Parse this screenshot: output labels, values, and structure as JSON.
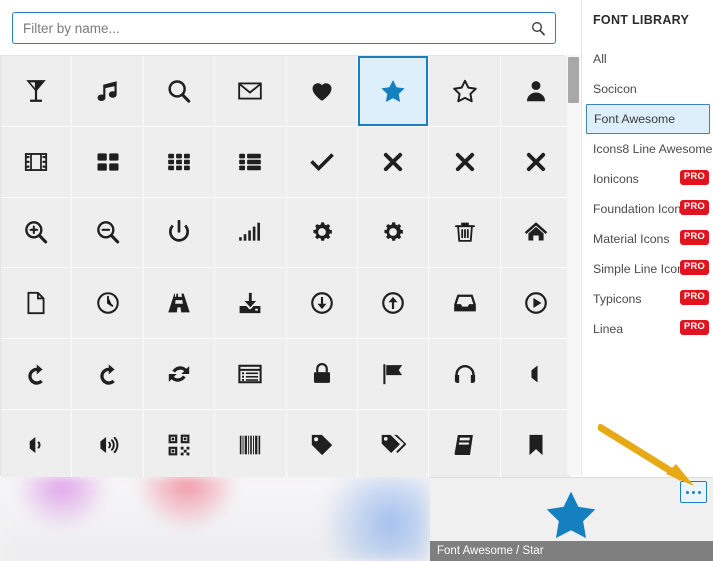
{
  "search": {
    "placeholder": "Filter by name...",
    "value": "",
    "icon": "search-icon"
  },
  "sidebar": {
    "title": "FONT LIBRARY",
    "items": [
      {
        "label": "All",
        "pro": "",
        "selected": false
      },
      {
        "label": "Socicon",
        "pro": "",
        "selected": false
      },
      {
        "label": "Font Awesome",
        "pro": "",
        "selected": true
      },
      {
        "label": "Icons8 Line Awesome",
        "pro": "",
        "selected": false
      },
      {
        "label": "Ionicons",
        "pro": "PRO",
        "selected": false
      },
      {
        "label": "Foundation Icons",
        "pro": "PRO",
        "selected": false
      },
      {
        "label": "Material Icons",
        "pro": "PRO",
        "selected": false
      },
      {
        "label": "Simple Line Icons",
        "pro": "PRO",
        "selected": false
      },
      {
        "label": "Typicons",
        "pro": "PRO",
        "selected": false
      },
      {
        "label": "Linea",
        "pro": "PRO",
        "selected": false
      }
    ]
  },
  "grid": {
    "columns": 8,
    "rows": 6,
    "icons": [
      {
        "name": "glass-icon",
        "selected": false
      },
      {
        "name": "music-icon",
        "selected": false
      },
      {
        "name": "search-icon",
        "selected": false
      },
      {
        "name": "envelope-icon",
        "selected": false
      },
      {
        "name": "heart-icon",
        "selected": false
      },
      {
        "name": "star-icon",
        "selected": true
      },
      {
        "name": "star-outline-icon",
        "selected": false
      },
      {
        "name": "user-icon",
        "selected": false
      },
      {
        "name": "film-icon",
        "selected": false
      },
      {
        "name": "th-large-icon",
        "selected": false
      },
      {
        "name": "th-icon",
        "selected": false
      },
      {
        "name": "th-list-icon",
        "selected": false
      },
      {
        "name": "check-icon",
        "selected": false
      },
      {
        "name": "close-icon",
        "selected": false
      },
      {
        "name": "remove-icon",
        "selected": false
      },
      {
        "name": "times-icon",
        "selected": false
      },
      {
        "name": "search-plus-icon",
        "selected": false
      },
      {
        "name": "search-minus-icon",
        "selected": false
      },
      {
        "name": "power-off-icon",
        "selected": false
      },
      {
        "name": "signal-icon",
        "selected": false
      },
      {
        "name": "cog-icon",
        "selected": false
      },
      {
        "name": "gear-icon",
        "selected": false
      },
      {
        "name": "trash-icon",
        "selected": false
      },
      {
        "name": "home-icon",
        "selected": false
      },
      {
        "name": "file-outline-icon",
        "selected": false
      },
      {
        "name": "clock-icon",
        "selected": false
      },
      {
        "name": "road-icon",
        "selected": false
      },
      {
        "name": "download-icon",
        "selected": false
      },
      {
        "name": "arrow-circle-down-icon",
        "selected": false
      },
      {
        "name": "arrow-circle-up-icon",
        "selected": false
      },
      {
        "name": "inbox-icon",
        "selected": false
      },
      {
        "name": "play-circle-icon",
        "selected": false
      },
      {
        "name": "repeat-icon",
        "selected": false
      },
      {
        "name": "refresh-icon",
        "selected": false
      },
      {
        "name": "sync-icon",
        "selected": false
      },
      {
        "name": "list-alt-icon",
        "selected": false
      },
      {
        "name": "lock-icon",
        "selected": false
      },
      {
        "name": "flag-icon",
        "selected": false
      },
      {
        "name": "headphones-icon",
        "selected": false
      },
      {
        "name": "volume-off-icon",
        "selected": false
      },
      {
        "name": "volume-down-icon",
        "selected": false
      },
      {
        "name": "volume-up-icon",
        "selected": false
      },
      {
        "name": "qrcode-icon",
        "selected": false
      },
      {
        "name": "barcode-icon",
        "selected": false
      },
      {
        "name": "tag-icon",
        "selected": false
      },
      {
        "name": "tags-icon",
        "selected": false
      },
      {
        "name": "book-icon",
        "selected": false
      },
      {
        "name": "bookmark-icon",
        "selected": false
      }
    ]
  },
  "preview": {
    "caption": "Font Awesome / Star",
    "icon": "star-icon",
    "more_button_label": "..."
  },
  "colors": {
    "accent_blue": "#1580c0",
    "selection_border": "#1b7fbd",
    "selection_fill": "#ddeffb",
    "pro_red": "#e0131e",
    "arrow_gold": "#e8a917",
    "cell_bg": "#eeeeee",
    "caption_bar": "#7f7f7f"
  }
}
